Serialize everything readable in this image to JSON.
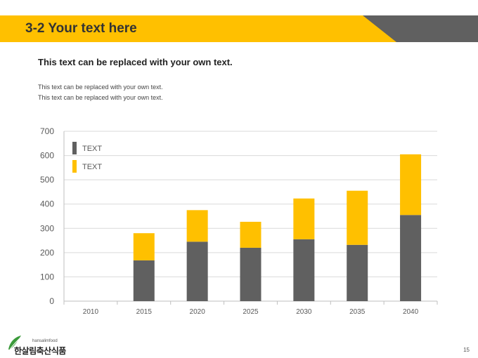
{
  "slide": {
    "title": "3-2 Your text here",
    "headline": "This text can be replaced with your own text.",
    "body_lines": [
      "This text can be replaced with your own text.",
      "This text can be replaced with your own text."
    ],
    "page_number": "15",
    "logo": {
      "small": "hansalimfood",
      "main": "한살림축산식품"
    },
    "colors": {
      "accent": "#FFC000",
      "dark": "#606060"
    }
  },
  "chart_data": {
    "type": "bar",
    "stacked": true,
    "categories": [
      "2010",
      "2015",
      "2020",
      "2025",
      "2030",
      "2035",
      "2040"
    ],
    "series": [
      {
        "name": "TEXT",
        "color": "#606060",
        "values": [
          0,
          168,
          245,
          220,
          255,
          232,
          355
        ]
      },
      {
        "name": "TEXT",
        "color": "#FFC000",
        "values": [
          0,
          112,
          130,
          107,
          168,
          223,
          250
        ]
      }
    ],
    "ylim": [
      0,
      700
    ],
    "yticks": [
      0,
      100,
      200,
      300,
      400,
      500,
      600,
      700
    ],
    "grid": true,
    "legend_position": "top-left"
  }
}
